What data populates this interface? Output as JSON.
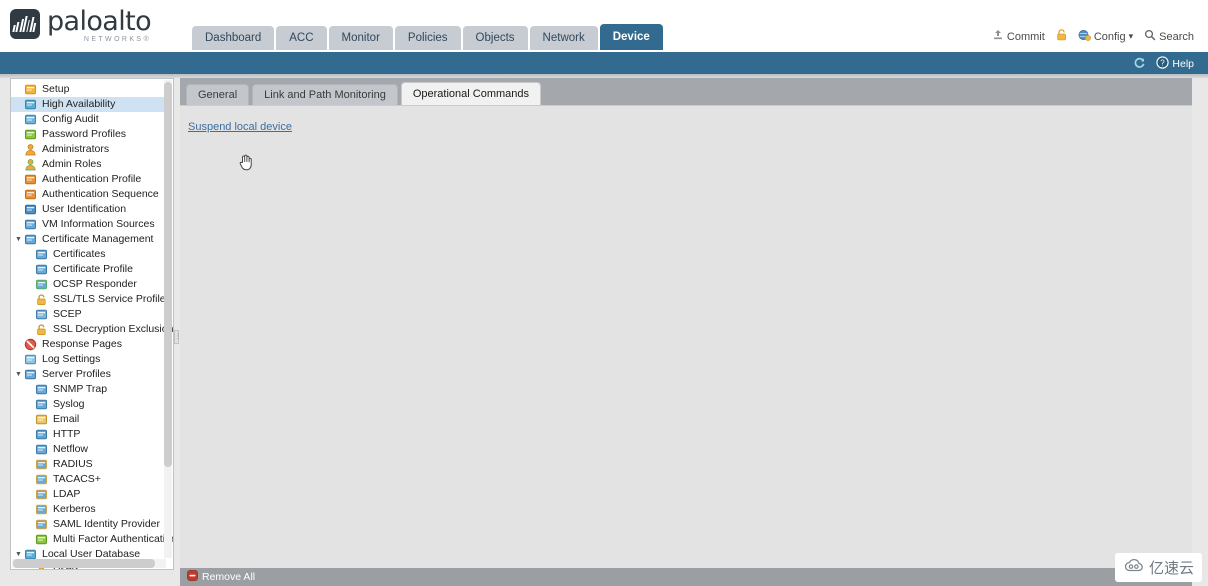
{
  "brand": {
    "word": "paloalto",
    "sub": "NETWORKS®",
    "logo_icon": "paloalto-logo-icon",
    "logo_bg": "#2f3a43"
  },
  "colors": {
    "accent_blue": "#336a8f",
    "tab_inactive": "#c6ccd2",
    "content_bg": "#a4a8ad",
    "panel_bg": "#e3e3e3",
    "link": "#3c6e9f",
    "selected_row": "#cfe2f3",
    "footer_bg": "#9b9fa4"
  },
  "main_tabs": [
    {
      "label": "Dashboard",
      "active": false
    },
    {
      "label": "ACC",
      "active": false
    },
    {
      "label": "Monitor",
      "active": false
    },
    {
      "label": "Policies",
      "active": false
    },
    {
      "label": "Objects",
      "active": false
    },
    {
      "label": "Network",
      "active": false
    },
    {
      "label": "Device",
      "active": true
    }
  ],
  "utility": {
    "commit": {
      "label": "Commit",
      "icon": "commit-icon"
    },
    "lock": {
      "icon": "padlock-icon"
    },
    "config": {
      "label": "Config",
      "icon": "config-icon",
      "caret": "▾"
    },
    "search": {
      "label": "Search",
      "icon": "search-icon"
    }
  },
  "band": {
    "refresh": {
      "icon": "refresh-icon"
    },
    "help": {
      "label": "Help",
      "icon": "help-icon"
    }
  },
  "sidebar": {
    "items": [
      {
        "label": "Setup",
        "depth": 0,
        "icon": "setup-icon",
        "twist": "",
        "selected": false
      },
      {
        "label": "High Availability",
        "depth": 0,
        "icon": "high-availability-icon",
        "twist": "",
        "selected": true
      },
      {
        "label": "Config Audit",
        "depth": 0,
        "icon": "config-audit-icon",
        "twist": "",
        "selected": false
      },
      {
        "label": "Password Profiles",
        "depth": 0,
        "icon": "password-profiles-icon",
        "twist": "",
        "selected": false
      },
      {
        "label": "Administrators",
        "depth": 0,
        "icon": "administrators-icon",
        "twist": "",
        "selected": false
      },
      {
        "label": "Admin Roles",
        "depth": 0,
        "icon": "admin-roles-icon",
        "twist": "",
        "selected": false
      },
      {
        "label": "Authentication Profile",
        "depth": 0,
        "icon": "authentication-profile-icon",
        "twist": "",
        "selected": false
      },
      {
        "label": "Authentication Sequence",
        "depth": 0,
        "icon": "authentication-sequence-icon",
        "twist": "",
        "selected": false
      },
      {
        "label": "User Identification",
        "depth": 0,
        "icon": "user-identification-icon",
        "twist": "",
        "selected": false
      },
      {
        "label": "VM Information Sources",
        "depth": 0,
        "icon": "vm-information-sources-icon",
        "twist": "",
        "selected": false
      },
      {
        "label": "Certificate Management",
        "depth": 0,
        "icon": "certificate-management-icon",
        "twist": "▼",
        "selected": false
      },
      {
        "label": "Certificates",
        "depth": 1,
        "icon": "certificates-icon",
        "twist": "",
        "selected": false
      },
      {
        "label": "Certificate Profile",
        "depth": 1,
        "icon": "certificate-profile-icon",
        "twist": "",
        "selected": false
      },
      {
        "label": "OCSP Responder",
        "depth": 1,
        "icon": "ocsp-responder-icon",
        "twist": "",
        "selected": false
      },
      {
        "label": "SSL/TLS Service Profile",
        "depth": 1,
        "icon": "padlock-icon",
        "twist": "",
        "selected": false
      },
      {
        "label": "SCEP",
        "depth": 1,
        "icon": "scep-icon",
        "twist": "",
        "selected": false
      },
      {
        "label": "SSL Decryption Exclusion",
        "depth": 1,
        "icon": "padlock-icon",
        "twist": "",
        "selected": false
      },
      {
        "label": "Response Pages",
        "depth": 0,
        "icon": "response-pages-icon",
        "twist": "",
        "selected": false
      },
      {
        "label": "Log Settings",
        "depth": 0,
        "icon": "log-settings-icon",
        "twist": "",
        "selected": false
      },
      {
        "label": "Server Profiles",
        "depth": 0,
        "icon": "server-profiles-icon",
        "twist": "▼",
        "selected": false
      },
      {
        "label": "SNMP Trap",
        "depth": 1,
        "icon": "snmp-trap-icon",
        "twist": "",
        "selected": false
      },
      {
        "label": "Syslog",
        "depth": 1,
        "icon": "syslog-icon",
        "twist": "",
        "selected": false
      },
      {
        "label": "Email",
        "depth": 1,
        "icon": "email-icon",
        "twist": "",
        "selected": false
      },
      {
        "label": "HTTP",
        "depth": 1,
        "icon": "http-icon",
        "twist": "",
        "selected": false
      },
      {
        "label": "Netflow",
        "depth": 1,
        "icon": "netflow-icon",
        "twist": "",
        "selected": false
      },
      {
        "label": "RADIUS",
        "depth": 1,
        "icon": "radius-icon",
        "twist": "",
        "selected": false
      },
      {
        "label": "TACACS+",
        "depth": 1,
        "icon": "tacacs-icon",
        "twist": "",
        "selected": false
      },
      {
        "label": "LDAP",
        "depth": 1,
        "icon": "ldap-icon",
        "twist": "",
        "selected": false
      },
      {
        "label": "Kerberos",
        "depth": 1,
        "icon": "kerberos-icon",
        "twist": "",
        "selected": false
      },
      {
        "label": "SAML Identity Provider",
        "depth": 1,
        "icon": "saml-identity-provider-icon",
        "twist": "",
        "selected": false
      },
      {
        "label": "Multi Factor Authentication",
        "depth": 1,
        "icon": "multi-factor-authentication-icon",
        "twist": "",
        "selected": false
      },
      {
        "label": "Local User Database",
        "depth": 0,
        "icon": "local-user-database-icon",
        "twist": "▼",
        "selected": false
      },
      {
        "label": "Users",
        "depth": 1,
        "icon": "users-icon",
        "twist": "",
        "selected": false
      }
    ]
  },
  "content": {
    "tabs": [
      {
        "label": "General",
        "active": false
      },
      {
        "label": "Link and Path Monitoring",
        "active": false
      },
      {
        "label": "Operational Commands",
        "active": true
      }
    ],
    "operational_commands": {
      "suspend_link": "Suspend local device"
    },
    "cursor": "pointing-hand-cursor"
  },
  "footer": {
    "remove_all": {
      "label": "Remove All",
      "icon": "remove-icon"
    }
  },
  "watermark": {
    "text": "亿速云",
    "icon": "cloud-icon"
  }
}
